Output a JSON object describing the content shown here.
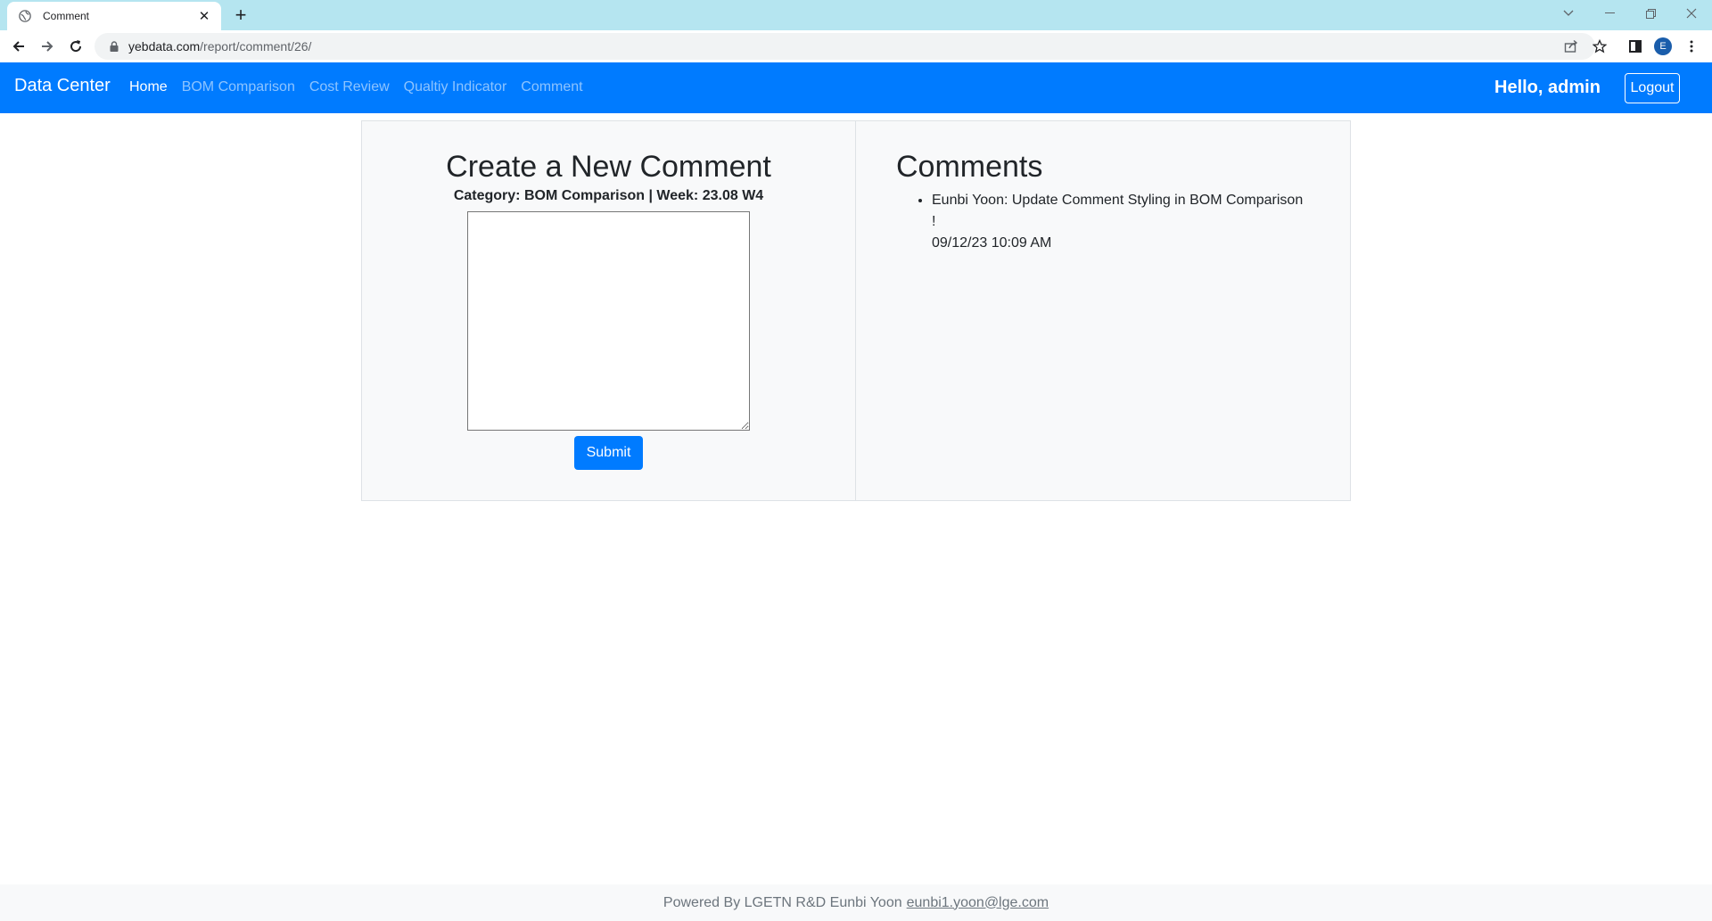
{
  "browser": {
    "tab_title": "Comment",
    "new_tab_symbol": "+",
    "url_host": "yebdata.com",
    "url_path": "/report/comment/26/",
    "profile_initial": "E"
  },
  "navbar": {
    "brand": "Data Center",
    "links": [
      "Home",
      "BOM Comparison",
      "Cost Review",
      "Qualtiy Indicator",
      "Comment"
    ],
    "active_link": "Home",
    "greeting": "Hello, admin",
    "logout_label": "Logout",
    "color": "#007bff"
  },
  "create": {
    "title": "Create a New Comment",
    "meta": "Category: BOM Comparison | Week: 23.08 W4",
    "textarea_value": "",
    "submit_label": "Submit"
  },
  "comments": {
    "title": "Comments",
    "items": [
      {
        "author": "Eunbi Yoon",
        "text": "Update Comment Styling in BOM Comparison !",
        "timestamp": "09/12/23 10:09 AM"
      }
    ]
  },
  "footer": {
    "text": "Powered By LGETN R&D Eunbi Yoon",
    "email": "eunbi1.yoon@lge.com"
  }
}
